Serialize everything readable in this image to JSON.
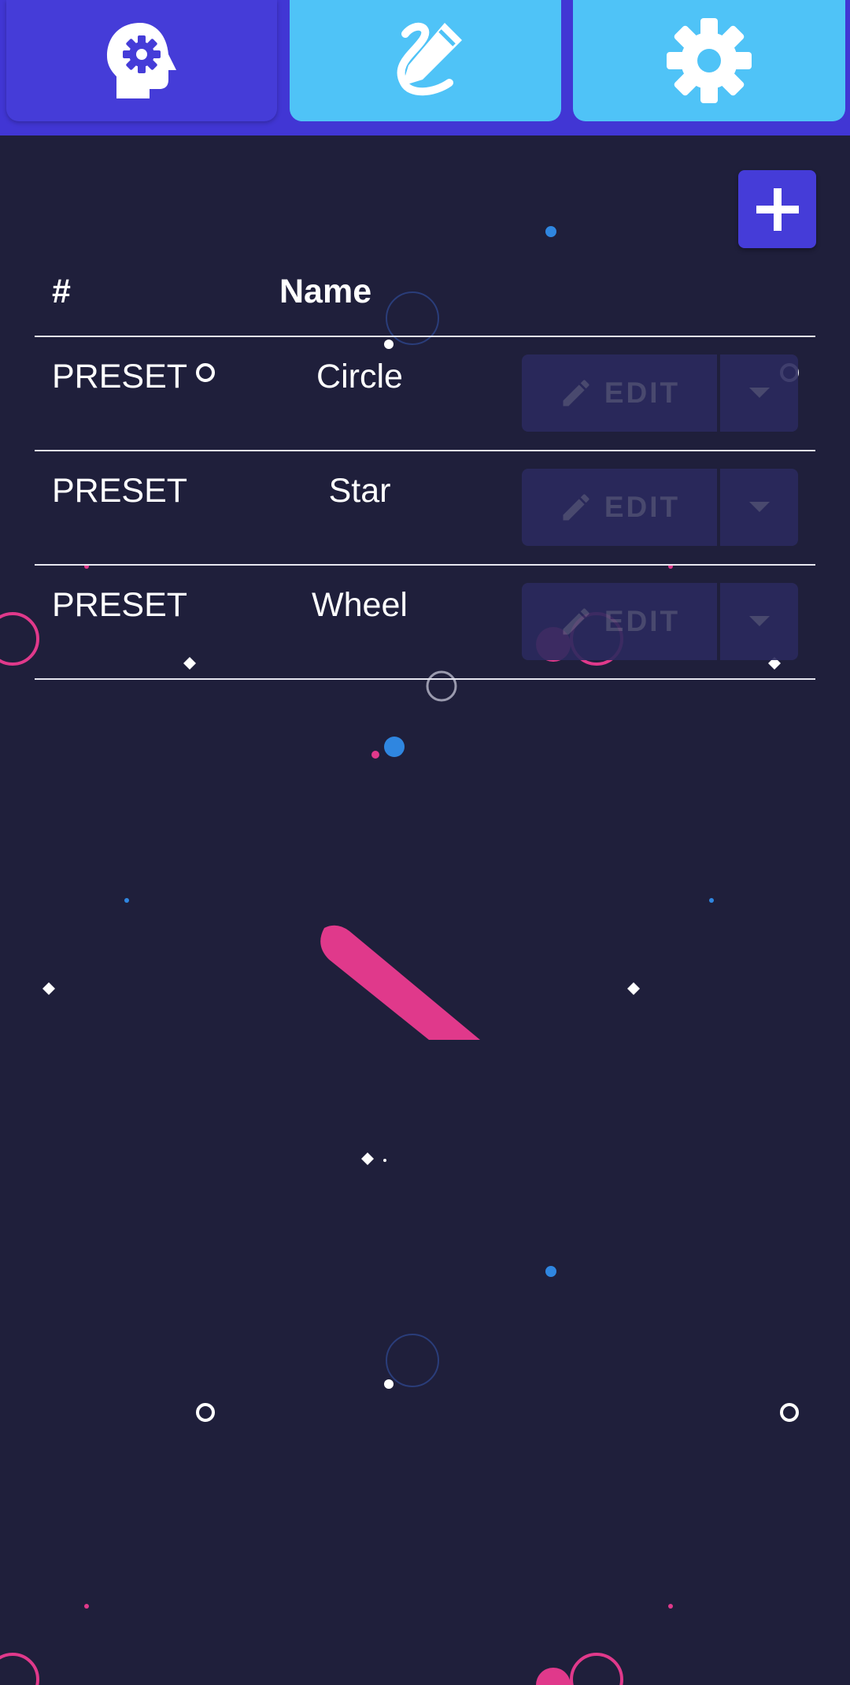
{
  "colors": {
    "background": "#1f1f3b",
    "topbar": "#4136d4",
    "active_tab": "#453cd8",
    "inactive_tab": "#4fc3f7",
    "accent_pink": "#e0398b",
    "accent_blue": "#2f86e0",
    "disabled_text": "#4e4e74",
    "disabled_button": "#2b2a5e"
  },
  "tabs": [
    {
      "icon": "head-gear-icon",
      "active": true
    },
    {
      "icon": "pencil-squiggle-icon",
      "active": false
    },
    {
      "icon": "gear-icon",
      "active": false
    }
  ],
  "add_button": {
    "icon": "plus-icon"
  },
  "table": {
    "headers": {
      "number": "#",
      "name": "Name"
    },
    "rows": [
      {
        "number": "PRESET",
        "name": "Circle",
        "edit_label": "EDIT"
      },
      {
        "number": "PRESET",
        "name": "Star",
        "edit_label": "EDIT"
      },
      {
        "number": "PRESET",
        "name": "Wheel",
        "edit_label": "EDIT"
      }
    ]
  }
}
